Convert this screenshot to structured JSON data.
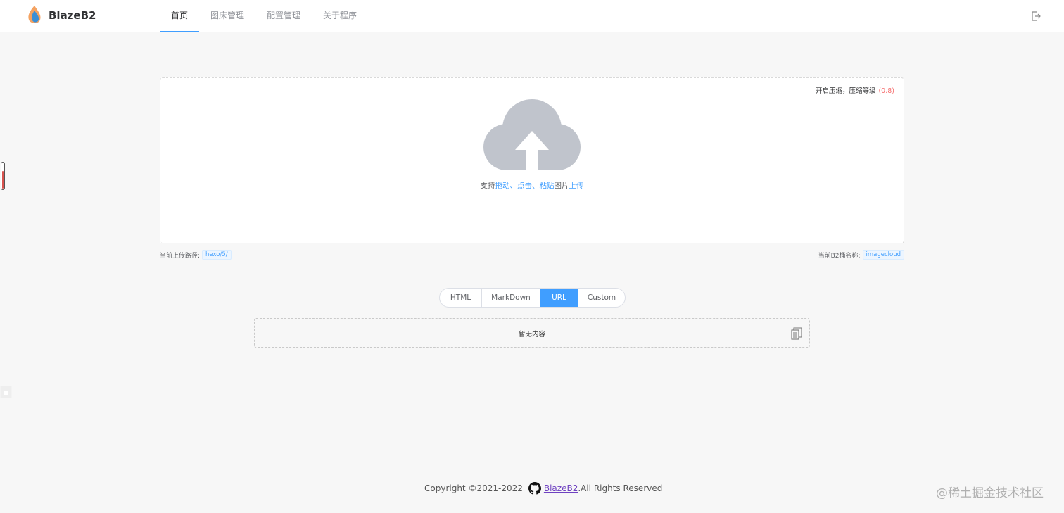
{
  "app": {
    "brand": "BlazeB2"
  },
  "nav": [
    {
      "label": "首页",
      "active": true
    },
    {
      "label": "图床管理",
      "active": false
    },
    {
      "label": "配置管理",
      "active": false
    },
    {
      "label": "关于程序",
      "active": false
    }
  ],
  "upload": {
    "compress_label": "开启压缩，压缩等级",
    "compress_level": "(0.8)",
    "hint_prefix": "支持",
    "hint_drag": "拖动",
    "hint_sep1": "、",
    "hint_click": "点击",
    "hint_sep2": "、",
    "hint_paste": "粘贴",
    "hint_middle": "图片",
    "hint_upload": "上传"
  },
  "meta": {
    "path_label": "当前上传路径:",
    "path_value": "hexo/5/",
    "bucket_label": "当前B2桶名称:",
    "bucket_value": "imagecloud"
  },
  "formats": [
    {
      "label": "HTML",
      "active": false
    },
    {
      "label": "MarkDown",
      "active": false
    },
    {
      "label": "URL",
      "active": true
    },
    {
      "label": "Custom",
      "active": false
    }
  ],
  "output": {
    "empty_text": "暂无内容"
  },
  "footer": {
    "copyright": "Copyright ©2021-2022",
    "link": "BlazeB2",
    "rights": ".All Rights Reserved"
  },
  "watermark": "@稀土掘金技术社区",
  "colors": {
    "accent": "#409eff",
    "level": "#f56c6c",
    "cloud": "#c0c4cc"
  },
  "icons": {
    "logo": "flame-logo-icon",
    "logout": "logout-icon",
    "upload": "cloud-upload-icon",
    "copy": "copy-icon",
    "github": "github-icon"
  }
}
